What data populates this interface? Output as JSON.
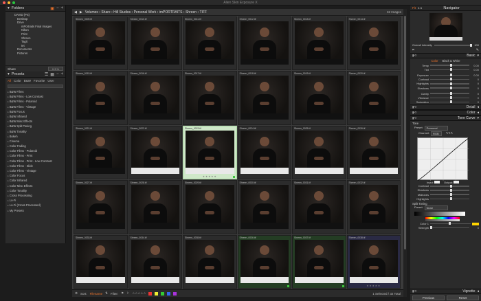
{
  "app": {
    "title": "Alien Skin Exposure X"
  },
  "colors": {
    "accent": "#e8702a",
    "select_green": "#3ec43e"
  },
  "folders": {
    "header": "Folders",
    "tree": [
      "DAVID (PS)",
      "Desktop",
      "Drive",
      "mPortraits Final Images",
      "Nikon",
      "Print",
      "Shreen",
      "Tagit",
      "tet",
      "Documents",
      "Pictures"
    ],
    "share_label": "Share",
    "share_value": "0.3 %"
  },
  "presets": {
    "header": "Presets",
    "tabs": [
      "All",
      "Color",
      "B&W",
      "Favorite",
      "User"
    ],
    "items": [
      "B&W Films",
      "B&W Films - Low Contrast",
      "B&W Films - Polaroid",
      "B&W Films - Vintage",
      "B&W Focus",
      "B&W Infrared",
      "B&W Misc Effects",
      "B&W Split Toning",
      "B&W Tonality",
      "Bokeh",
      "Cinema",
      "Color Fading",
      "Color Films - Polaroid",
      "Color Films - Print",
      "Color Films - Print - Low Contrast",
      "Color Films - Slide",
      "Color Films - Vintage",
      "Color Focus",
      "Color Infrared",
      "Color Misc Effects",
      "Color Tonality",
      "Cross Processing",
      "Lo-Fi",
      "Lo-Fi (Cross Processed)",
      "My Presets"
    ]
  },
  "breadcrumb": {
    "path": "Volumes › Share › Hill Studios › Personal Work › imPORTRAITS › Shreen › TIFF",
    "count": "32 Images"
  },
  "grid": {
    "files": [
      "Shreen_0009.tif",
      "Shreen_0010.tif",
      "Shreen_0011.tif",
      "Shreen_0012.tif",
      "Shreen_0013.tif",
      "Shreen_0014.tif",
      "Shreen_0015.tif",
      "Shreen_0016.tif",
      "Shreen_0017.tif",
      "Shreen_0018.tif",
      "Shreen_0019.tif",
      "Shreen_0020.tif",
      "Shreen_0021.tif",
      "Shreen_0022.tif",
      "Shreen_0023.tif",
      "Shreen_0024.tif",
      "Shreen_0025.tif",
      "Shreen_0026.tif",
      "Shreen_0027.tif",
      "Shreen_0028.tif",
      "Shreen_0029.tif",
      "Shreen_0030.tif",
      "Shreen_0031.tif",
      "Shreen_0032.tif",
      "Shreen_0033.tif",
      "Shreen_0034.tif",
      "Shreen_0035.tif",
      "Shreen_0036.tif",
      "Shreen_0037.tif",
      "Shreen_0038.tif"
    ]
  },
  "bottom": {
    "sort_label": "Sort:",
    "sort_value": "Filename",
    "filter_label": "Filter:",
    "status": "1 Selected / 32 Total"
  },
  "navigator": {
    "title": "Navigator",
    "fit": "Fit",
    "one": "1:1",
    "intensity_label": "Overall Intensity",
    "intensity_value": "100"
  },
  "basic": {
    "title": "Basic",
    "tabs": [
      "Color",
      "Black & White"
    ],
    "sliders": [
      {
        "name": "Temp",
        "value": "0.00"
      },
      {
        "name": "Tint",
        "value": "0.00"
      },
      {
        "name": "Exposure",
        "value": "0.00"
      },
      {
        "name": "Contrast",
        "value": "0"
      },
      {
        "name": "Highlights",
        "value": "0"
      },
      {
        "name": "Shadows",
        "value": "0"
      },
      {
        "name": "Clarity",
        "value": "0"
      },
      {
        "name": "Vibrance",
        "value": "0"
      },
      {
        "name": "Saturation",
        "value": "0"
      }
    ]
  },
  "detail": {
    "title": "Detail"
  },
  "color": {
    "title": "Color"
  },
  "tone_curve": {
    "title": "Tone Curve",
    "tone": "Tone",
    "preset_label": "Preset:",
    "preset_value": "Personal",
    "channel_label": "Channel:",
    "channel_value": "RGB",
    "input": "Input:",
    "output": "Output:",
    "sliders": [
      {
        "name": "Contrast"
      },
      {
        "name": "Shadows"
      },
      {
        "name": "Midtones"
      },
      {
        "name": "Highlights"
      }
    ]
  },
  "split_toning": {
    "title": "Split Toning",
    "preset_label": "Preset:",
    "preset_value": "None",
    "color_label": "Color 1",
    "strength_label": "Strength",
    "strength_value": "0"
  },
  "vignette": {
    "title": "Vignette"
  },
  "footer": {
    "previous": "Previous",
    "reset": "Reset"
  }
}
